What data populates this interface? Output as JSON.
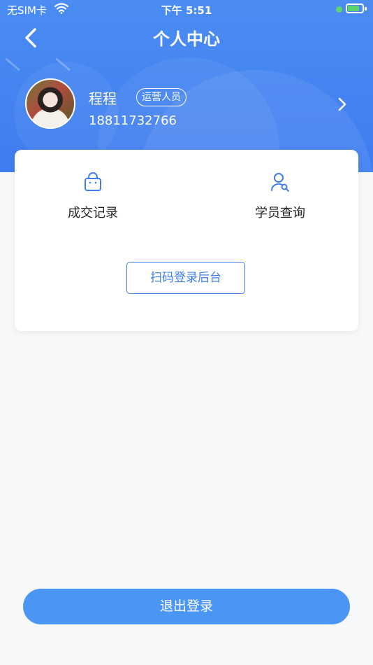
{
  "status_bar": {
    "carrier": "无SIM卡",
    "time": "下午 5:51",
    "battery_level": 0.74
  },
  "nav": {
    "title": "个人中心",
    "back_icon": "chevron-left-icon"
  },
  "profile": {
    "name": "程程",
    "role": "运营人员",
    "phone": "18811732766",
    "chevron_icon": "chevron-right-icon"
  },
  "card": {
    "functions": [
      {
        "label": "成交记录",
        "icon": "shopping-bag-icon"
      },
      {
        "label": "学员查询",
        "icon": "user-search-icon"
      }
    ],
    "scan_button_label": "扫码登录后台"
  },
  "logout_label": "退出登录",
  "colors": {
    "primary": "#3f7df0",
    "header_gradient_top": "#4b8cf2",
    "logout_button": "#4b96f5",
    "background": "#f7f8fa"
  }
}
